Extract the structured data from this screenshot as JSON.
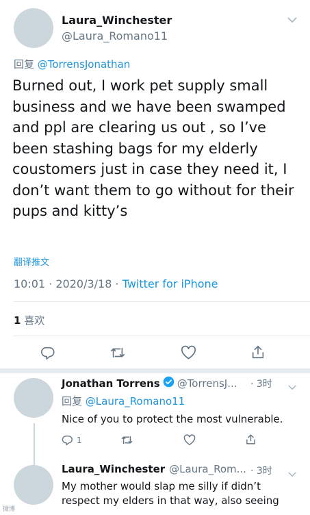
{
  "main_tweet": {
    "author_name": "Laura_Winchester",
    "author_handle": "@Laura_Romano11",
    "reply_prefix": "回复",
    "reply_to": "@TorrensJonathan",
    "text": "Burned out, I work pet supply small business and we have been swamped and ppl are clearing us out , so I’ve been stashing bags for my elderly coustomers just in case they need it, I don’t want them to go without for their pups and kitty’s",
    "translate_label": "翻译推文",
    "time": "10:01",
    "date": "2020/3/18",
    "source": "Twitter for iPhone",
    "likes_count": "1",
    "likes_label": "喜欢"
  },
  "replies": [
    {
      "author_name": "Jonathan Torrens",
      "verified": true,
      "author_handle": "@TorrensJ...",
      "time": "· 3时",
      "reply_prefix": "回复",
      "reply_to": "@Laura_Romano11",
      "text": "Nice of you to protect the most vulnerable.",
      "reply_count": "1"
    },
    {
      "author_name": "Laura_Winchester",
      "author_handle": "@Laura_Rom...",
      "time": "· 3时",
      "text": "My mother would slap me silly if didn’t respect my elders in that way, also seeing"
    }
  ],
  "icons": [
    "chevron-down-icon",
    "reply-icon",
    "retweet-icon",
    "like-icon",
    "share-icon",
    "verified-badge-icon"
  ],
  "colors": {
    "link": "#1b95e0",
    "muted": "#657786",
    "verified": "#1da1f2",
    "divider": "#e1e8ed",
    "avatar": "#ccd6dd"
  },
  "watermark": "微博"
}
